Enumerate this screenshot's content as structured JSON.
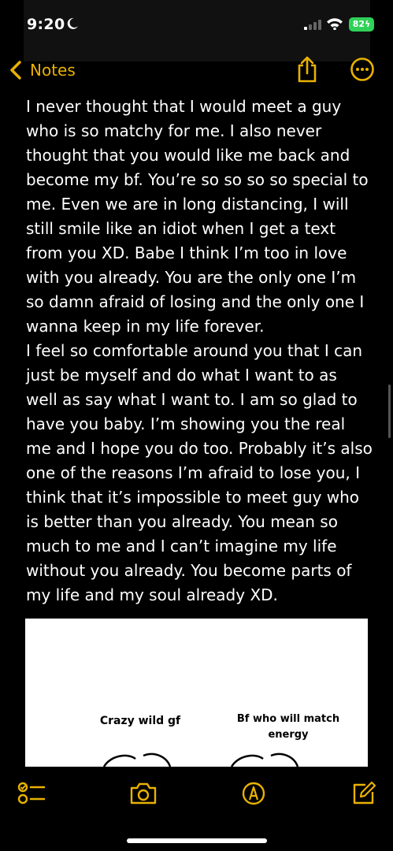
{
  "status_bar": {
    "time": "9:20",
    "battery": "82"
  },
  "nav": {
    "back_label": "Notes"
  },
  "note": {
    "paragraphs": [
      "I never thought that I would meet a guy who is so matchy for me.  I also never thought that you would like me back and become my bf. You’re so so so so special to me. Even we are in long distancing, I will still smile like an idiot when I get a text from you XD. Babe I think I’m too in love with you already. You are the only one I’m so damn afraid of losing and the only one I wanna keep in my life forever.",
      "I feel so comfortable around you that I can just be myself and do what I want to as well as say what I want to. I am so glad to have you baby. I’m showing you the real me and I hope you do too. Probably it’s also one of the reasons I’m afraid to lose you, I think that it’s impossible to meet guy who is better than you already. You mean so much to me and I can’t imagine my life without you already. You become parts of my life and my soul already XD."
    ]
  },
  "attachment": {
    "left_caption": "Crazy wild gf",
    "right_caption": "Bf who will match energy"
  },
  "colors": {
    "accent": "#e9b200",
    "background": "#000000",
    "battery": "#2fd158"
  },
  "icons": {
    "checklist": "checklist-icon",
    "camera": "camera-icon",
    "markup": "markup-icon",
    "compose": "compose-icon",
    "share": "share-icon",
    "more": "more-icon"
  }
}
